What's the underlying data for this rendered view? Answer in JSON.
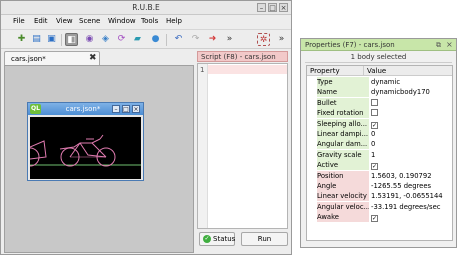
{
  "app": {
    "title": "R.U.B.E",
    "menus": [
      "File",
      "Edit",
      "View",
      "Scene",
      "Window",
      "Tools",
      "Help"
    ]
  },
  "editor": {
    "tab_label": "cars.json*",
    "doc_window_title": "cars.json*",
    "doc_icon": "QL"
  },
  "script": {
    "title": "Script (F8) - cars.json",
    "line_number": "1",
    "status_label": "Status",
    "run_label": "Run"
  },
  "properties": {
    "title": "Properties (F7) - cars.json",
    "selection_info": "1 body selected",
    "header_property": "Property",
    "header_value": "Value",
    "rows": [
      {
        "name": "Type",
        "value": "dynamic",
        "checkbox": false,
        "bg": "#e2f2d5"
      },
      {
        "name": "Name",
        "value": "dynamicbody170",
        "checkbox": false,
        "bg": "#e2f2d5"
      },
      {
        "name": "Bullet",
        "value": "",
        "checkbox": true,
        "checked": false,
        "bg": "#e2f2d5"
      },
      {
        "name": "Fixed rotation",
        "value": "",
        "checkbox": true,
        "checked": false,
        "bg": "#e2f2d5"
      },
      {
        "name": "Sleeping allo...",
        "value": "",
        "checkbox": true,
        "checked": true,
        "bg": "#e2f2d5"
      },
      {
        "name": "Linear dampi...",
        "value": "0",
        "checkbox": false,
        "bg": "#e2f2d5"
      },
      {
        "name": "Angular dam...",
        "value": "0",
        "checkbox": false,
        "bg": "#e2f2d5"
      },
      {
        "name": "Gravity scale",
        "value": "1",
        "checkbox": false,
        "bg": "#e2f2d5"
      },
      {
        "name": "Active",
        "value": "",
        "checkbox": true,
        "checked": true,
        "bg": "#e2f2d5"
      },
      {
        "name": "Position",
        "value": "1.5603, 0.190792",
        "checkbox": false,
        "bg": "#f5dada"
      },
      {
        "name": "Angle",
        "value": "-1265.55 degrees",
        "checkbox": false,
        "bg": "#f5dada"
      },
      {
        "name": "Linear velocity",
        "value": "1.53191, -0.0655144",
        "checkbox": false,
        "bg": "#f5dada"
      },
      {
        "name": "Angular veloc...",
        "value": "-33.191 degrees/sec",
        "checkbox": false,
        "bg": "#f5dada"
      },
      {
        "name": "Awake",
        "value": "",
        "checkbox": true,
        "checked": true,
        "bg": "#f5dada"
      }
    ]
  }
}
